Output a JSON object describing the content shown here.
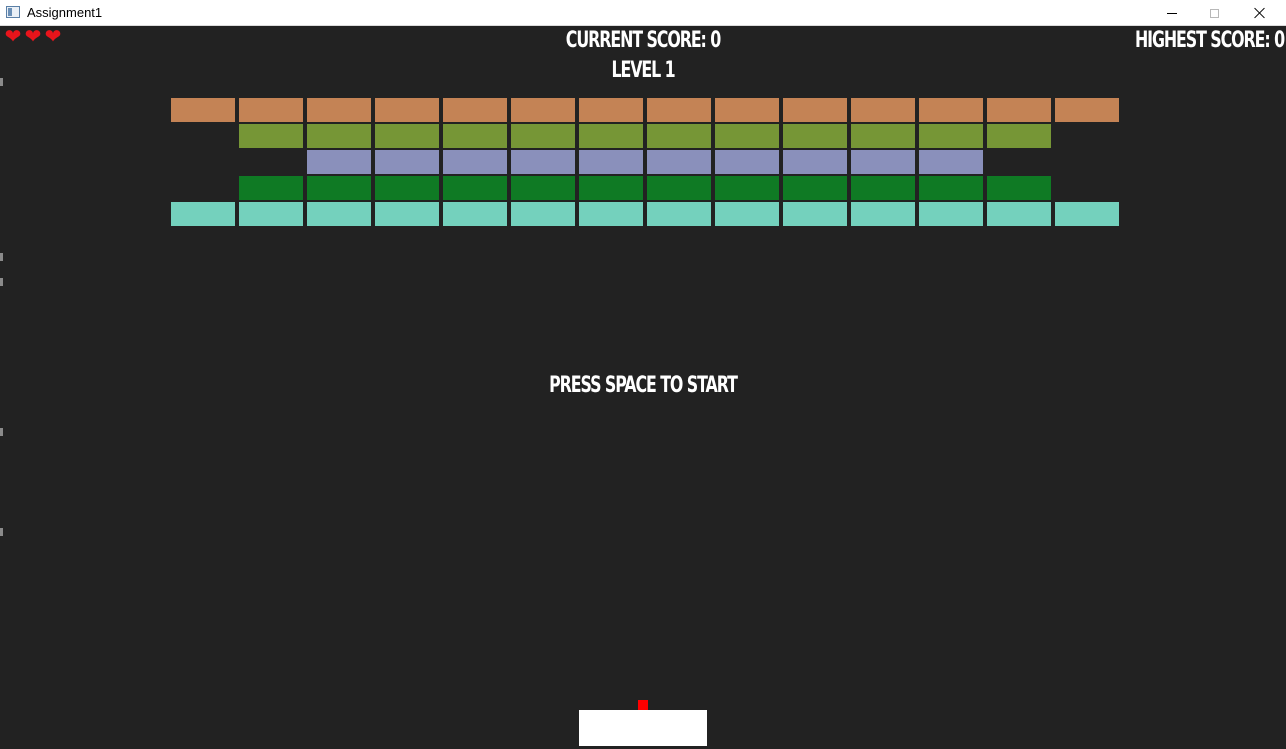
{
  "window": {
    "title": "Assignment1",
    "icon": "app-window-icon",
    "controls": [
      "minimize-icon",
      "maximize-icon",
      "close-icon"
    ]
  },
  "hud": {
    "current_score": "CURRENT SCORE: 0",
    "level": "LEVEL 1",
    "highest_score": "HIGHEST SCORE: 0",
    "prompt": "PRESS SPACE TO START",
    "lives": 3,
    "life_icon": "heart-icon"
  },
  "colors": {
    "background": "#222222",
    "text": "#ffffff",
    "heart": "#e8141b",
    "paddle": "#ffffff",
    "ball": "#ff0000"
  },
  "bricks": {
    "rows": [
      {
        "color": "#c48355",
        "columns": [
          0,
          1,
          2,
          3,
          4,
          5,
          6,
          7,
          8,
          9,
          10,
          11,
          12,
          13
        ]
      },
      {
        "color": "#769636",
        "columns": [
          1,
          2,
          3,
          4,
          5,
          6,
          7,
          8,
          9,
          10,
          11,
          12
        ]
      },
      {
        "color": "#8a90bb",
        "columns": [
          2,
          3,
          4,
          5,
          6,
          7,
          8,
          9,
          10,
          11
        ]
      },
      {
        "color": "#0f7a24",
        "columns": [
          1,
          2,
          3,
          4,
          5,
          6,
          7,
          8,
          9,
          10,
          11,
          12
        ]
      },
      {
        "color": "#74d1bd",
        "columns": [
          0,
          1,
          2,
          3,
          4,
          5,
          6,
          7,
          8,
          9,
          10,
          11,
          12,
          13
        ]
      }
    ]
  }
}
